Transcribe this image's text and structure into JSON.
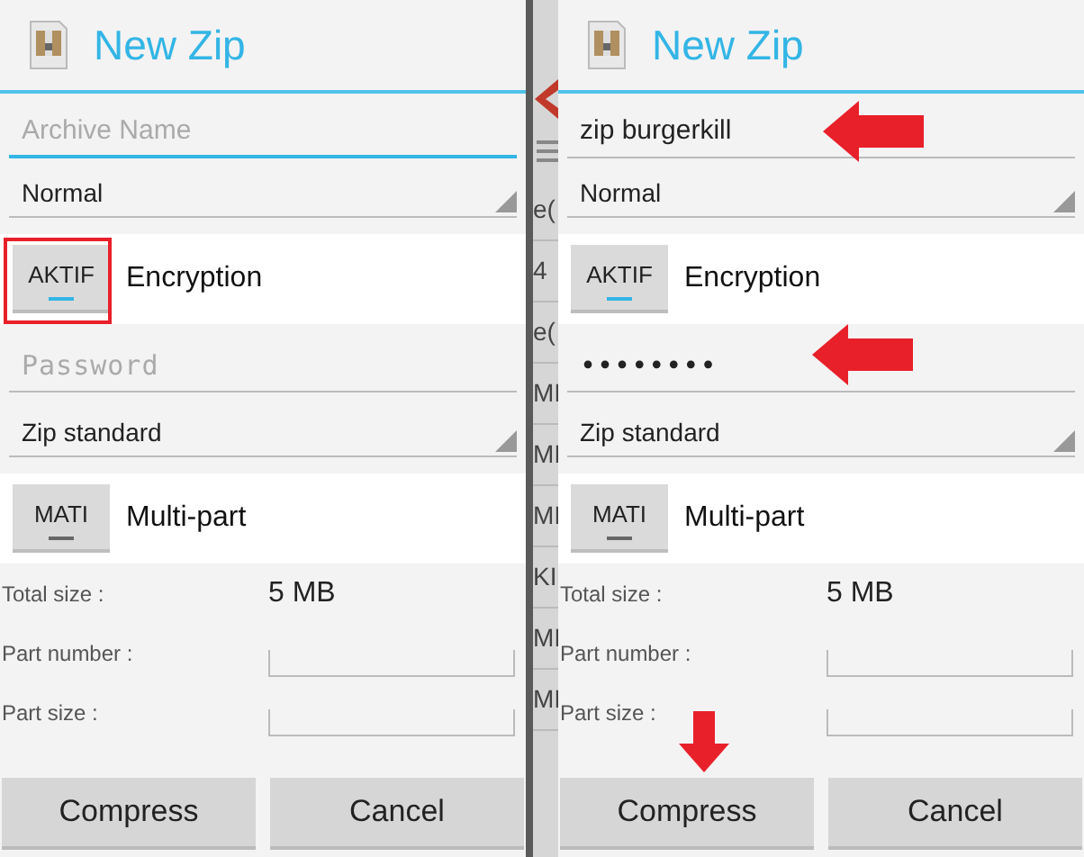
{
  "dialogs": [
    {
      "title": "New Zip",
      "archive_name": {
        "placeholder": "Archive Name",
        "focused": true
      },
      "compression": {
        "value": "Normal"
      },
      "encryption": {
        "button": "AKTIF",
        "on": true,
        "label": "Encryption",
        "highlighted": true
      },
      "password": {
        "placeholder": "Password"
      },
      "method": {
        "value": "Zip standard"
      },
      "multipart": {
        "button": "MATI",
        "on": false,
        "label": "Multi-part"
      },
      "total_size": {
        "label": "Total size :",
        "value": "5 MB"
      },
      "part_number": {
        "label": "Part number :"
      },
      "part_size": {
        "label": "Part size :"
      },
      "buttons": [
        {
          "label": "Compress"
        },
        {
          "label": "Cancel"
        }
      ]
    },
    {
      "title": "New Zip",
      "archive_name": {
        "value": "zip burgerkill",
        "focused": false,
        "arrow": true
      },
      "compression": {
        "value": "Normal"
      },
      "encryption": {
        "button": "AKTIF",
        "on": true,
        "label": "Encryption"
      },
      "password": {
        "value": "••••••••",
        "arrow": true
      },
      "method": {
        "value": "Zip standard"
      },
      "multipart": {
        "button": "MATI",
        "on": false,
        "label": "Multi-part"
      },
      "total_size": {
        "label": "Total size :",
        "value": "5 MB"
      },
      "part_number": {
        "label": "Part number :"
      },
      "part_size": {
        "label": "Part size :"
      },
      "buttons": [
        {
          "label": "Compress",
          "arrow": true
        },
        {
          "label": "Cancel"
        }
      ]
    }
  ],
  "background_fragments": [
    "e(",
    "4",
    "e(",
    "MI",
    "MI",
    "MI",
    "KI",
    "MI",
    "MI"
  ]
}
